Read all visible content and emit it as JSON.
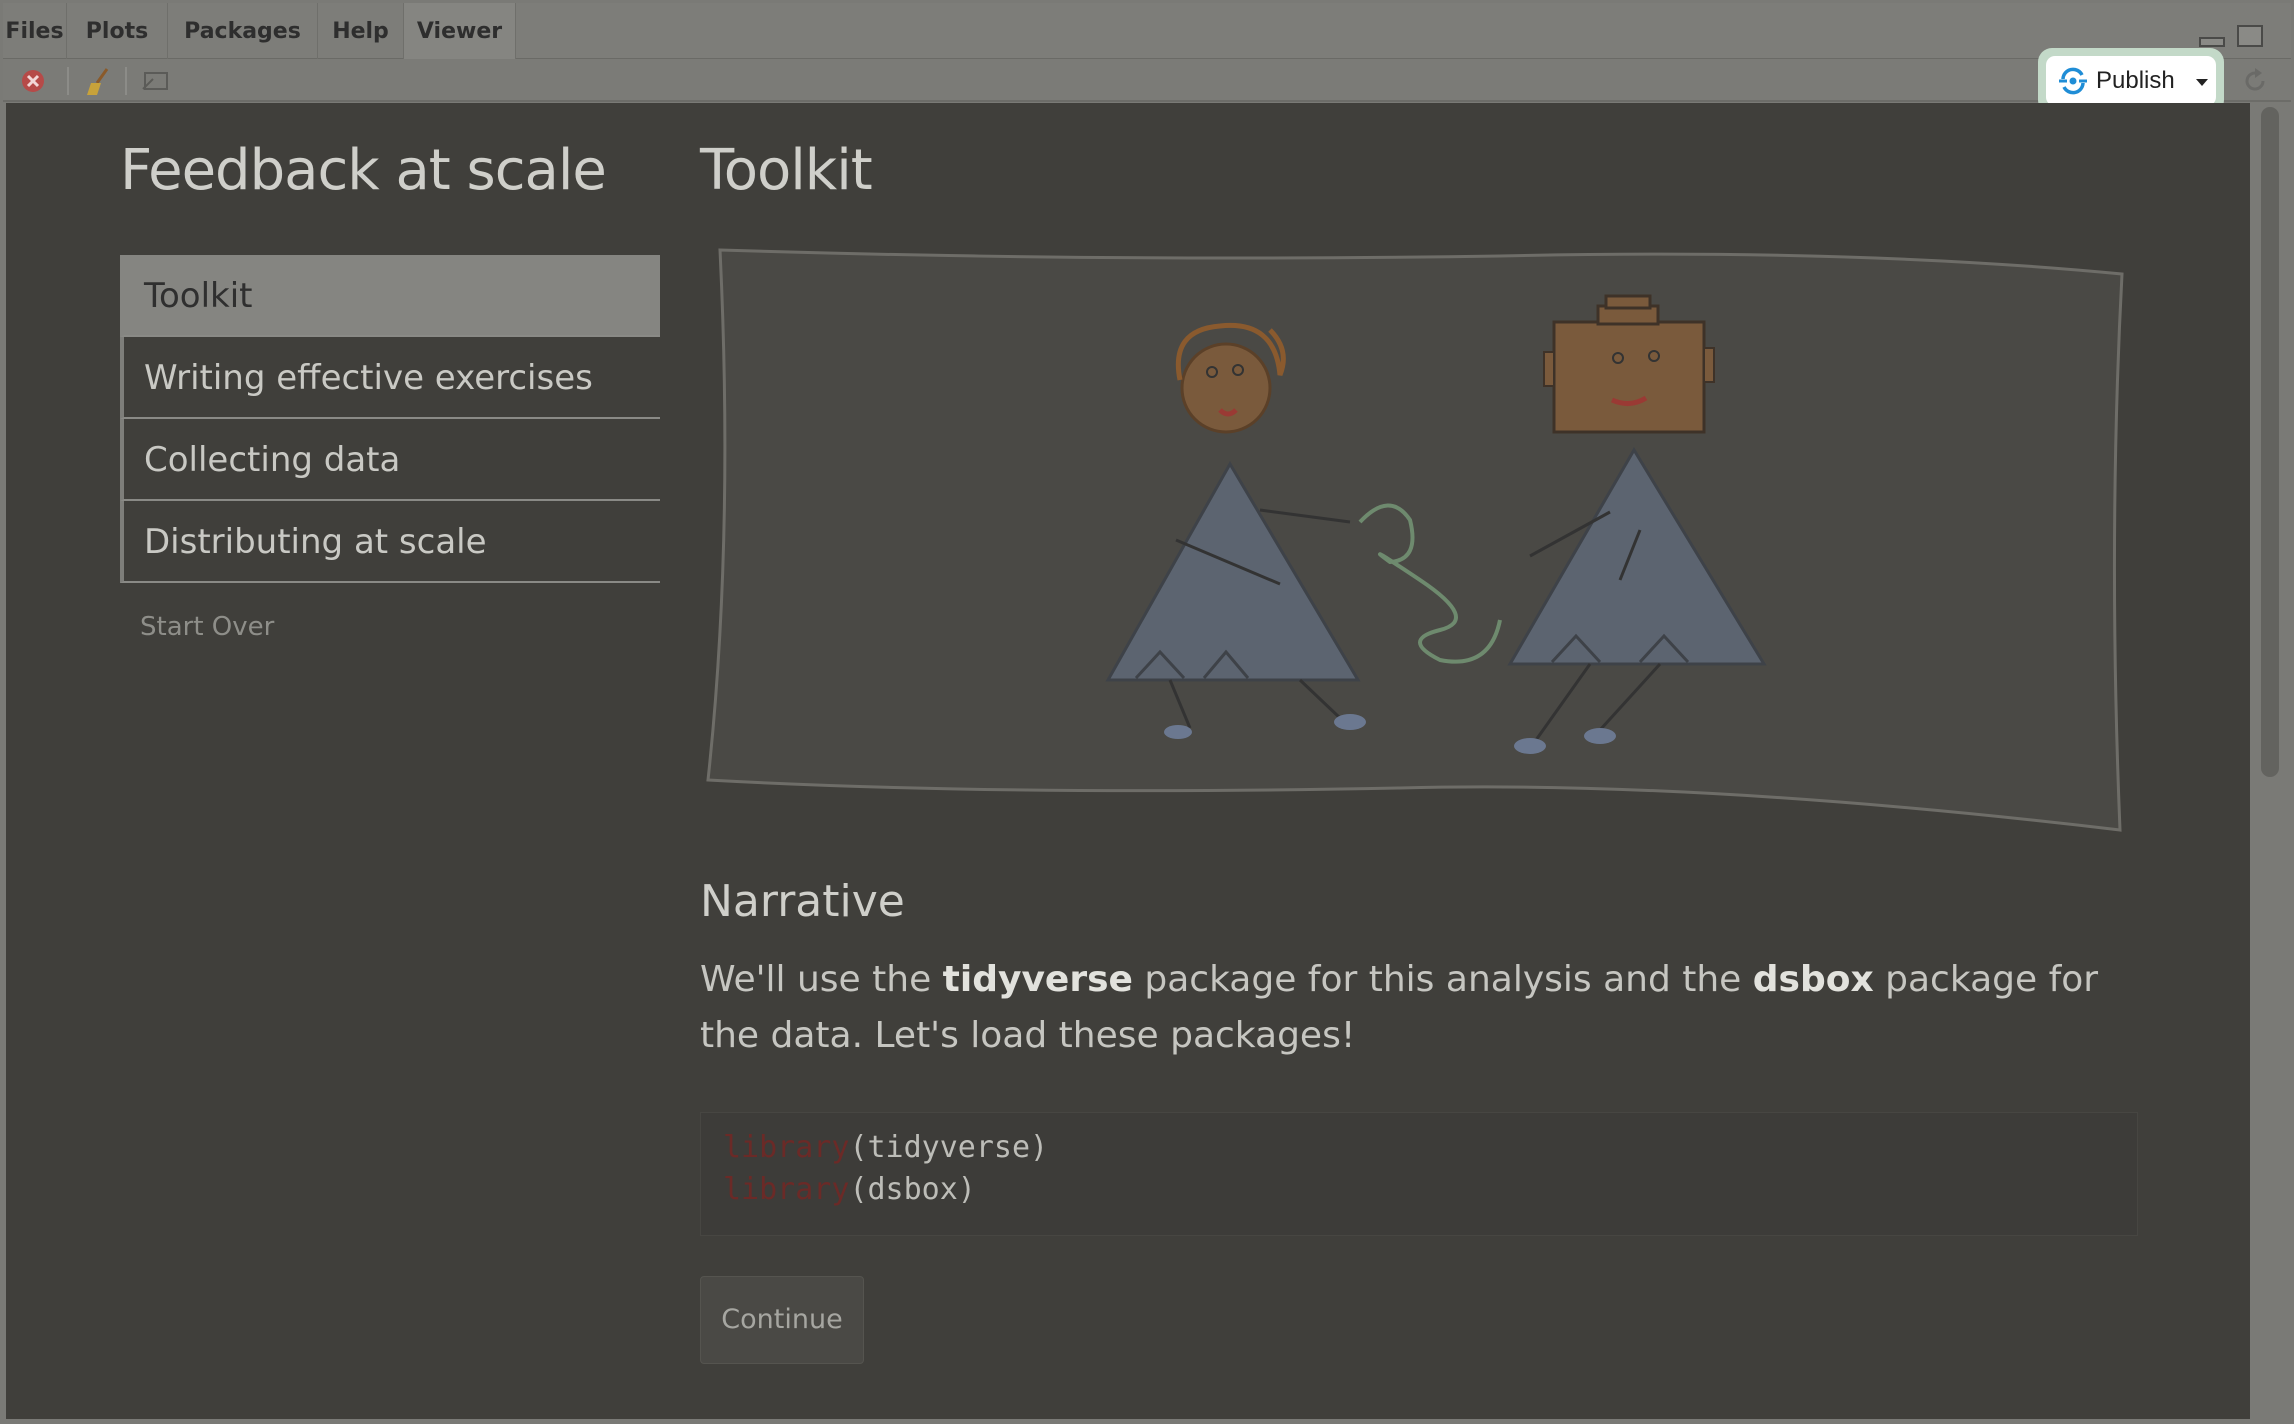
{
  "pane_tabs": [
    {
      "label": "Files"
    },
    {
      "label": "Plots"
    },
    {
      "label": "Packages"
    },
    {
      "label": "Help"
    },
    {
      "label": "Viewer"
    }
  ],
  "active_tab": "Viewer",
  "toolbar": {
    "icons": [
      "remove-viewer-icon",
      "clear-broom-icon",
      "show-in-window-icon",
      "refresh-icon"
    ],
    "publish_label": "Publish"
  },
  "tutorial": {
    "app_title": "Feedback at scale",
    "nav_items": [
      {
        "label": "Toolkit",
        "active": true
      },
      {
        "label": "Writing effective exercises",
        "active": false
      },
      {
        "label": "Collecting data",
        "active": false
      },
      {
        "label": "Distributing at scale",
        "active": false
      }
    ],
    "start_over": "Start Over",
    "section_title": "Toolkit",
    "narrative_heading": "Narrative",
    "paragraph": {
      "t1": "We'll use the ",
      "b1": "tidyverse",
      "t2": " package for this analysis and the ",
      "b2": "dsbox",
      "t3": " package for the data. Let's load these packages!"
    },
    "code": [
      {
        "fn": "library",
        "arg": "(tidyverse)"
      },
      {
        "fn": "library",
        "arg": "(dsbox)"
      }
    ],
    "continue_label": "Continue"
  },
  "colors": {
    "publish_icon": "#1f8dd6",
    "viewer_bg": "#403f3b",
    "accent_highlight": "#c3d9c8"
  }
}
